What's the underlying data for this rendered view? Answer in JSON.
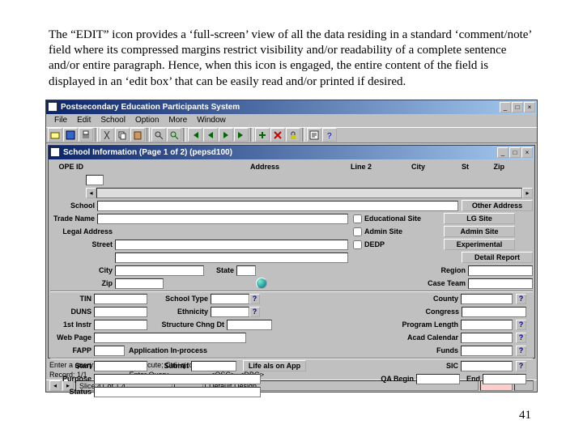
{
  "intro_text": "The “EDIT” icon provides a ‘full-screen’ view of all the data residing in a standard ‘comment/note’ field where its compressed margins restrict visibility and/or readability of a complete sentence and/or entire paragraph.  Hence, when this icon is engaged, the entire content of the field is displayed in an ‘edit box’ that can be easily read and/or printed if desired.",
  "page_number": "41",
  "app_title": "Postsecondary Education Participants System",
  "inner_title": "School Information (Page 1 of 2) (pepsd100)",
  "menu": {
    "file": "File",
    "edit": "Edit",
    "school": "School",
    "option": "Option",
    "more": "More",
    "window": "Window"
  },
  "labels": {
    "ope_id": "OPE ID",
    "address": "Address",
    "line2": "Line 2",
    "city": "City",
    "st": "St",
    "zip": "Zip",
    "school": "School",
    "trade_name": "Trade Name",
    "legal_address": "Legal Address",
    "street": "Street",
    "city2": "City",
    "state": "State",
    "zip2": "Zip",
    "tin": "TIN",
    "duns": "DUNS",
    "first_instr": "1st Instr",
    "web_page": "Web Page",
    "fapp": "FAPP",
    "start": "Start",
    "purpose": "Purpose",
    "status": "Status",
    "school_type": "School Type",
    "ethnicity": "Ethnicity",
    "structure_chng_dt": "Structure Chng Dt",
    "app_inprocess": "Application In-process",
    "submit": "Submit",
    "region": "Region",
    "case_team": "Case Team",
    "county": "County",
    "congress": "Congress",
    "program_length": "Program Length",
    "acad_calendar": "Acad Calendar",
    "funds": "Funds",
    "sic": "SIC",
    "qa_begin": "QA Begin",
    "end": "End"
  },
  "checkboxes": {
    "edu_site": "Educational Site",
    "admin_site": "Admin Site",
    "dedp": "DEDP "
  },
  "buttons": {
    "other_address": "Other Address",
    "lg_site": "LG Site",
    "admin_site_btn": "Admin Site",
    "experimental": "Experimental",
    "detail_report": "Detail Report",
    "life_also_app": "Life als on App"
  },
  "hint1": "Enter a query; press F8 to execute; Ctrl+q to cancel.",
  "hint2": "Record: 1/1",
  "hint2b": "Enter Query",
  "hint2c": "<OSC>",
  "hint2d": "<DBG>",
  "status": {
    "slice": "Slice 41 of 1,4",
    "design": "Default Design"
  }
}
